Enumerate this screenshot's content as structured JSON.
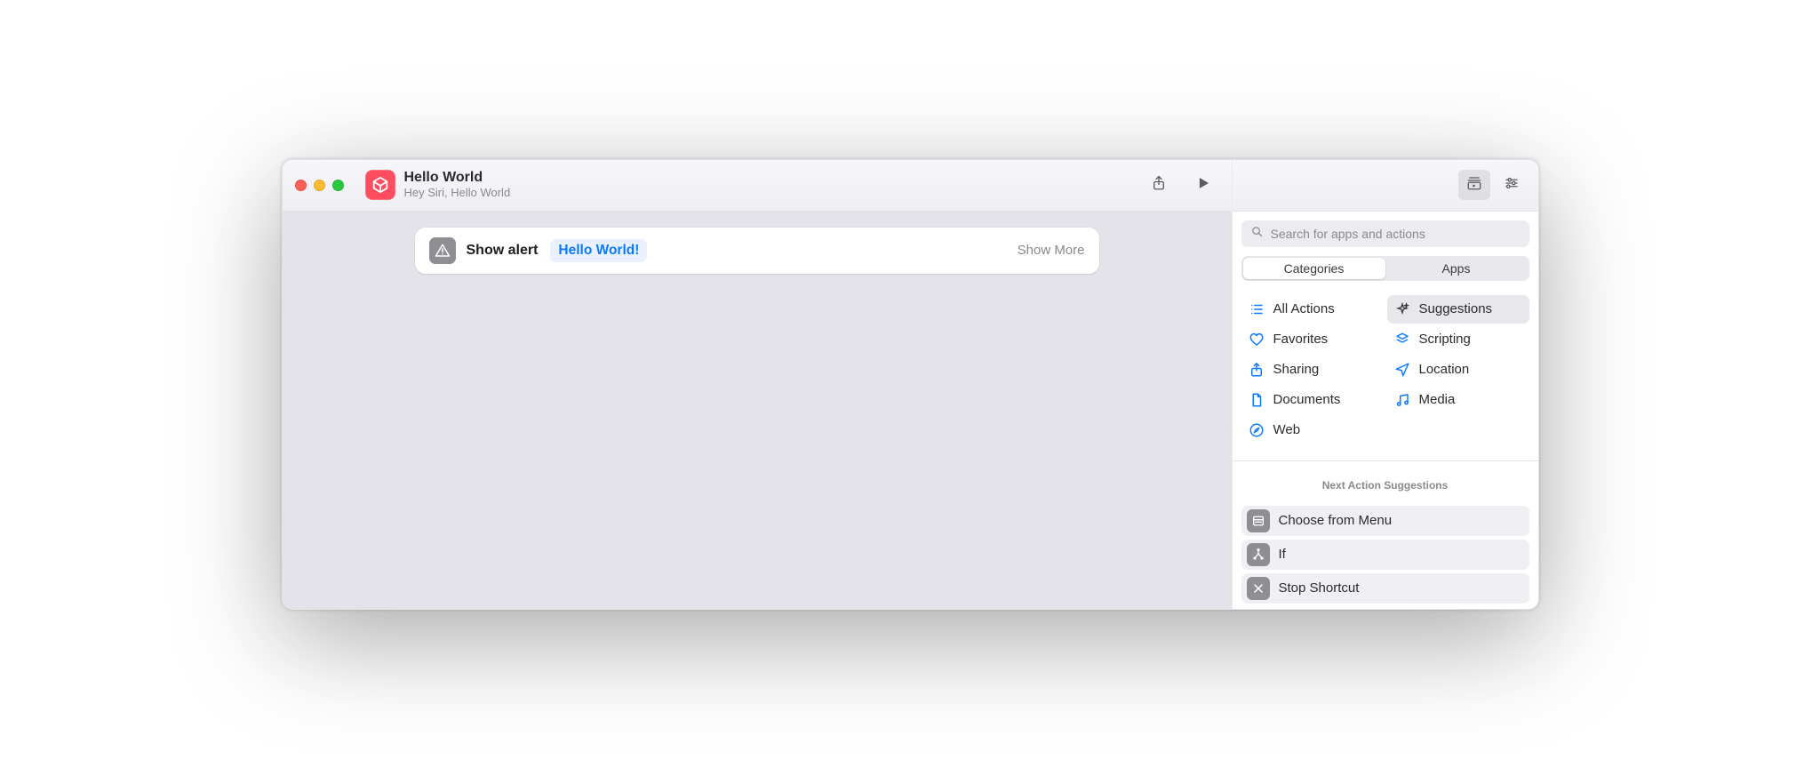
{
  "window": {
    "title": "Hello World",
    "subtitle": "Hey Siri, Hello World"
  },
  "toolbar": {
    "share_icon": "share-icon",
    "play_icon": "play-icon"
  },
  "action": {
    "name": "Show alert",
    "token": "Hello World!",
    "show_more": "Show More"
  },
  "sidebar": {
    "search_placeholder": "Search for apps and actions",
    "segmented": {
      "left": "Categories",
      "right": "Apps",
      "active": "left"
    },
    "categories": {
      "all_actions": "All Actions",
      "suggestions": "Suggestions",
      "favorites": "Favorites",
      "scripting": "Scripting",
      "sharing": "Sharing",
      "location": "Location",
      "documents": "Documents",
      "media": "Media",
      "web": "Web"
    },
    "suggestions_header": "Next Action Suggestions",
    "suggestions": {
      "choose_from_menu": "Choose from Menu",
      "if": "If",
      "stop_shortcut": "Stop Shortcut"
    }
  }
}
